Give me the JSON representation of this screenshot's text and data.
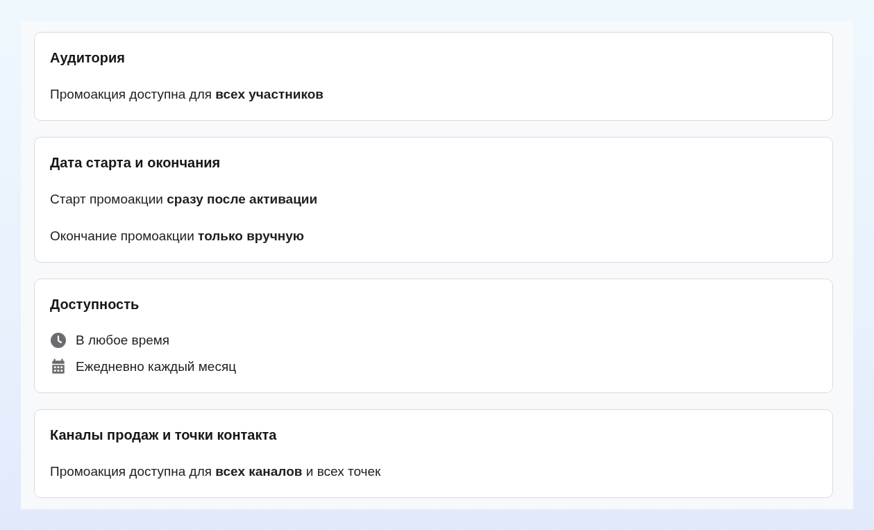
{
  "sections": [
    {
      "title": "Аудитория",
      "lines": [
        {
          "kind": "paragraph",
          "text": "Промоакция доступна для **всех участников**"
        }
      ]
    },
    {
      "title": "Дата старта и окончания",
      "lines": [
        {
          "kind": "paragraph",
          "text": "Старт промоакции **сразу после активации**"
        },
        {
          "kind": "paragraph",
          "text": "Окончание промоакции **только вручную**"
        }
      ]
    },
    {
      "title": "Доступность",
      "lines": [
        {
          "kind": "clock",
          "text": "В любое время"
        },
        {
          "kind": "calendar",
          "text": "Ежедневно каждый месяц"
        }
      ]
    },
    {
      "title": "Каналы продаж и точки контакта",
      "lines": [
        {
          "kind": "paragraph",
          "text": "Промоакция доступна для **всех каналов** и всех точек"
        }
      ]
    }
  ]
}
